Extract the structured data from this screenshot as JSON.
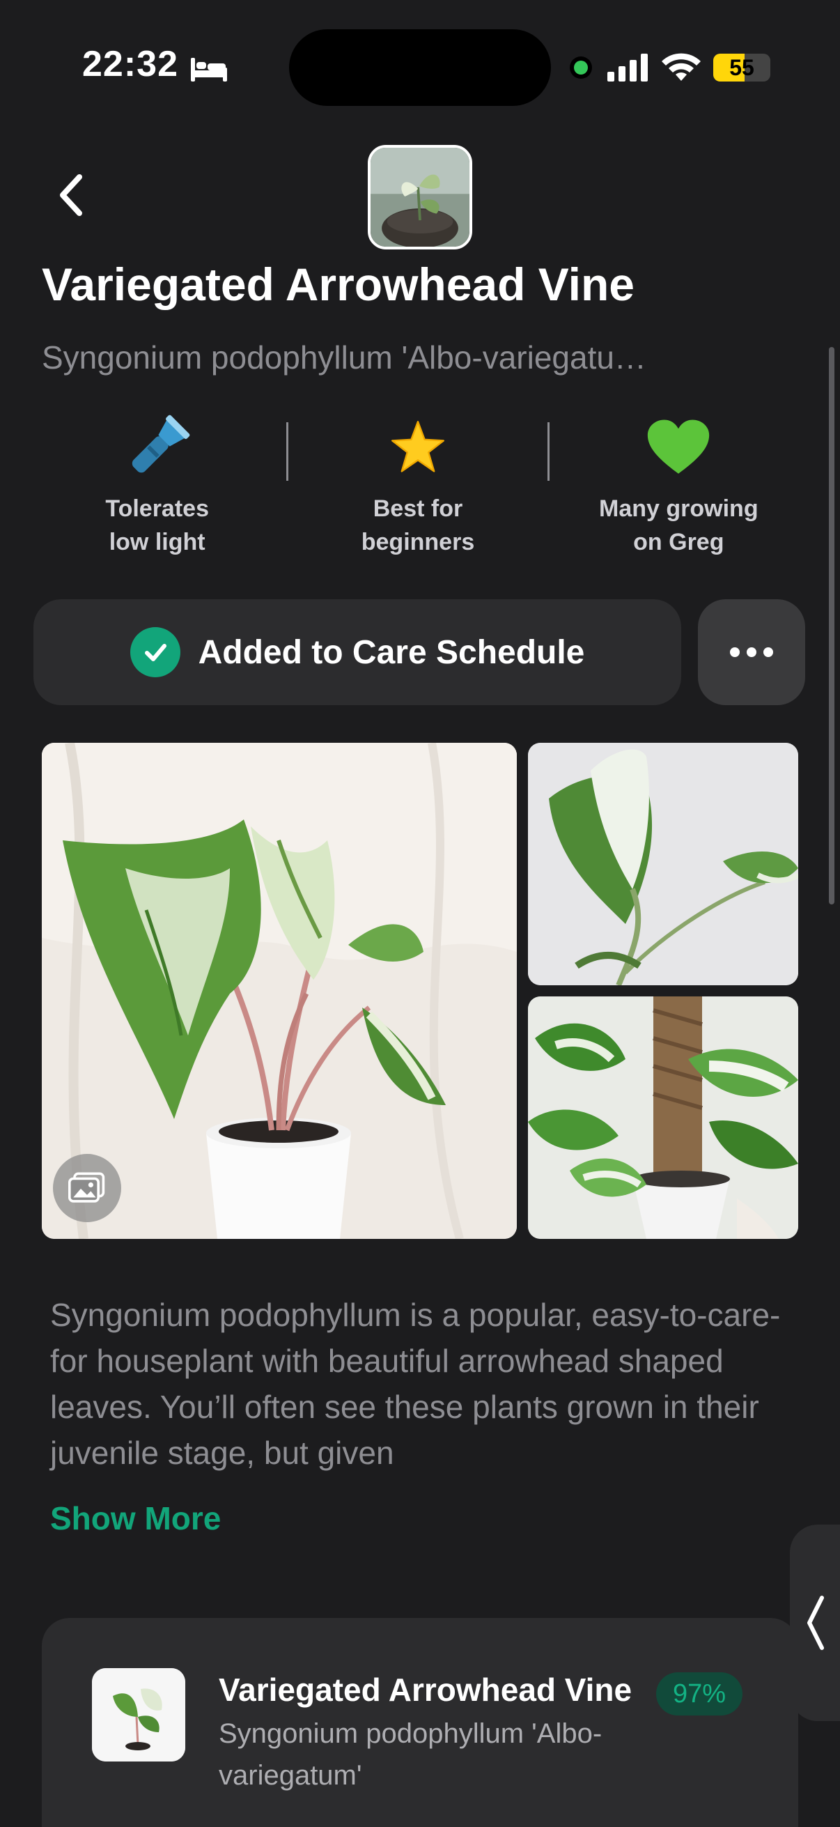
{
  "status_bar": {
    "time": "22:32",
    "battery": "55",
    "battery_level": 0.55
  },
  "header": {
    "title": "Variegated Arrowhead Vine",
    "subtitle": "Syngonium podophyllum 'Albo-variegatu…"
  },
  "features": [
    {
      "icon": "flashlight-icon",
      "label": "Tolerates\nlow light"
    },
    {
      "icon": "star-icon",
      "label": "Best for\nbeginners"
    },
    {
      "icon": "green-heart-icon",
      "label": "Many growing\non Greg"
    }
  ],
  "care_button": {
    "label": "Added to Care Schedule"
  },
  "description": {
    "text": "Syngonium podophyllum is a popular, easy-to-care-for houseplant with beautiful arrowhead shaped leaves. You’ll often see these plants grown in their juvenile stage, but given",
    "show_more": "Show More"
  },
  "identification": {
    "name": "Variegated Arrowhead Vine",
    "confidence": "97%",
    "scientific_name": "Syngonium podophyllum 'Albo-variegatum'"
  },
  "colors": {
    "background": "#1c1c1e",
    "card": "#2c2c2e",
    "accent": "#12a57a"
  }
}
